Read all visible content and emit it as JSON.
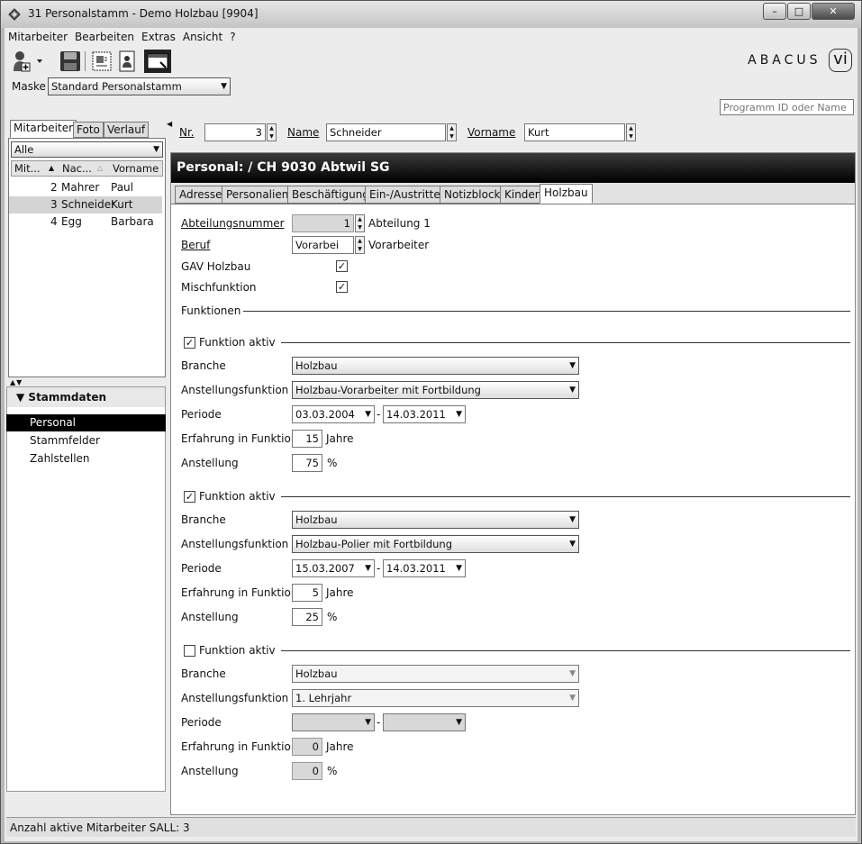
{
  "window": {
    "title": "31 Personalstamm - Demo Holzbau [9904]"
  },
  "menu": [
    "Mitarbeiter",
    "Bearbeiten",
    "Extras",
    "Ansicht",
    "?"
  ],
  "brand": {
    "name": "ABACUS",
    "mark": "vi"
  },
  "maske": {
    "label": "Maske",
    "value": "Standard Personalstamm"
  },
  "program_search": {
    "placeholder": "Programm ID oder Name"
  },
  "left_tabs": [
    "Mitarbeiter",
    "Foto",
    "Verlauf"
  ],
  "filter": {
    "value": "Alle"
  },
  "employee_table": {
    "headers": [
      "Mit...",
      "Nac...",
      "Vorname"
    ],
    "rows": [
      {
        "nr": "2",
        "name": "Mahrer",
        "vorname": "Paul"
      },
      {
        "nr": "3",
        "name": "Schneider",
        "vorname": "Kurt"
      },
      {
        "nr": "4",
        "name": "Egg",
        "vorname": "Barbara"
      }
    ]
  },
  "nav": {
    "section": "Stammdaten",
    "items": [
      "Personal",
      "Stammfelder",
      "Zahlstellen"
    ]
  },
  "status_bar": "Anzahl aktive Mitarbeiter SALL: 3",
  "record": {
    "nr_label": "Nr.",
    "nr_value": "3",
    "name_label": "Name",
    "name_value": "Schneider",
    "vorname_label": "Vorname",
    "vorname_value": "Kurt"
  },
  "header_banner": "Personal:  / CH 9030 Abtwil SG",
  "tabs": [
    "Adresse",
    "Personalien",
    "Beschäftigung",
    "Ein-/Austritte",
    "Notizblock",
    "Kinder",
    "Holzbau"
  ],
  "holzbau": {
    "abteilung_label": "Abteilungsnummer",
    "abteilung_value": "1",
    "abteilung_desc": "Abteilung 1",
    "beruf_label": "Beruf",
    "beruf_value": "Vorarbei",
    "beruf_desc": "Vorarbeiter",
    "gav_label": "GAV Holzbau",
    "misch_label": "Mischfunktion",
    "funktionen_label": "Funktionen",
    "labels": {
      "aktiv": "Funktion aktiv",
      "branche": "Branche",
      "anstellungsfunktion": "Anstellungsfunktion",
      "periode": "Periode",
      "erfahrung": "Erfahrung in Funktion",
      "jahre": "Jahre",
      "anstellung": "Anstellung",
      "percent": "%",
      "dash": "-"
    },
    "funktionen": [
      {
        "branche": "Holzbau",
        "anstellungsfunktion": "Holzbau-Vorarbeiter mit Fortbildung",
        "von": "03.03.2004",
        "bis": "14.03.2011",
        "erfahrung": "15",
        "anstellung": "75"
      },
      {
        "branche": "Holzbau",
        "anstellungsfunktion": "Holzbau-Polier mit Fortbildung",
        "von": "15.03.2007",
        "bis": "14.03.2011",
        "erfahrung": "5",
        "anstellung": "25"
      },
      {
        "branche": "Holzbau",
        "anstellungsfunktion": "1. Lehrjahr",
        "von": "",
        "bis": "",
        "erfahrung": "0",
        "anstellung": "0"
      }
    ]
  }
}
